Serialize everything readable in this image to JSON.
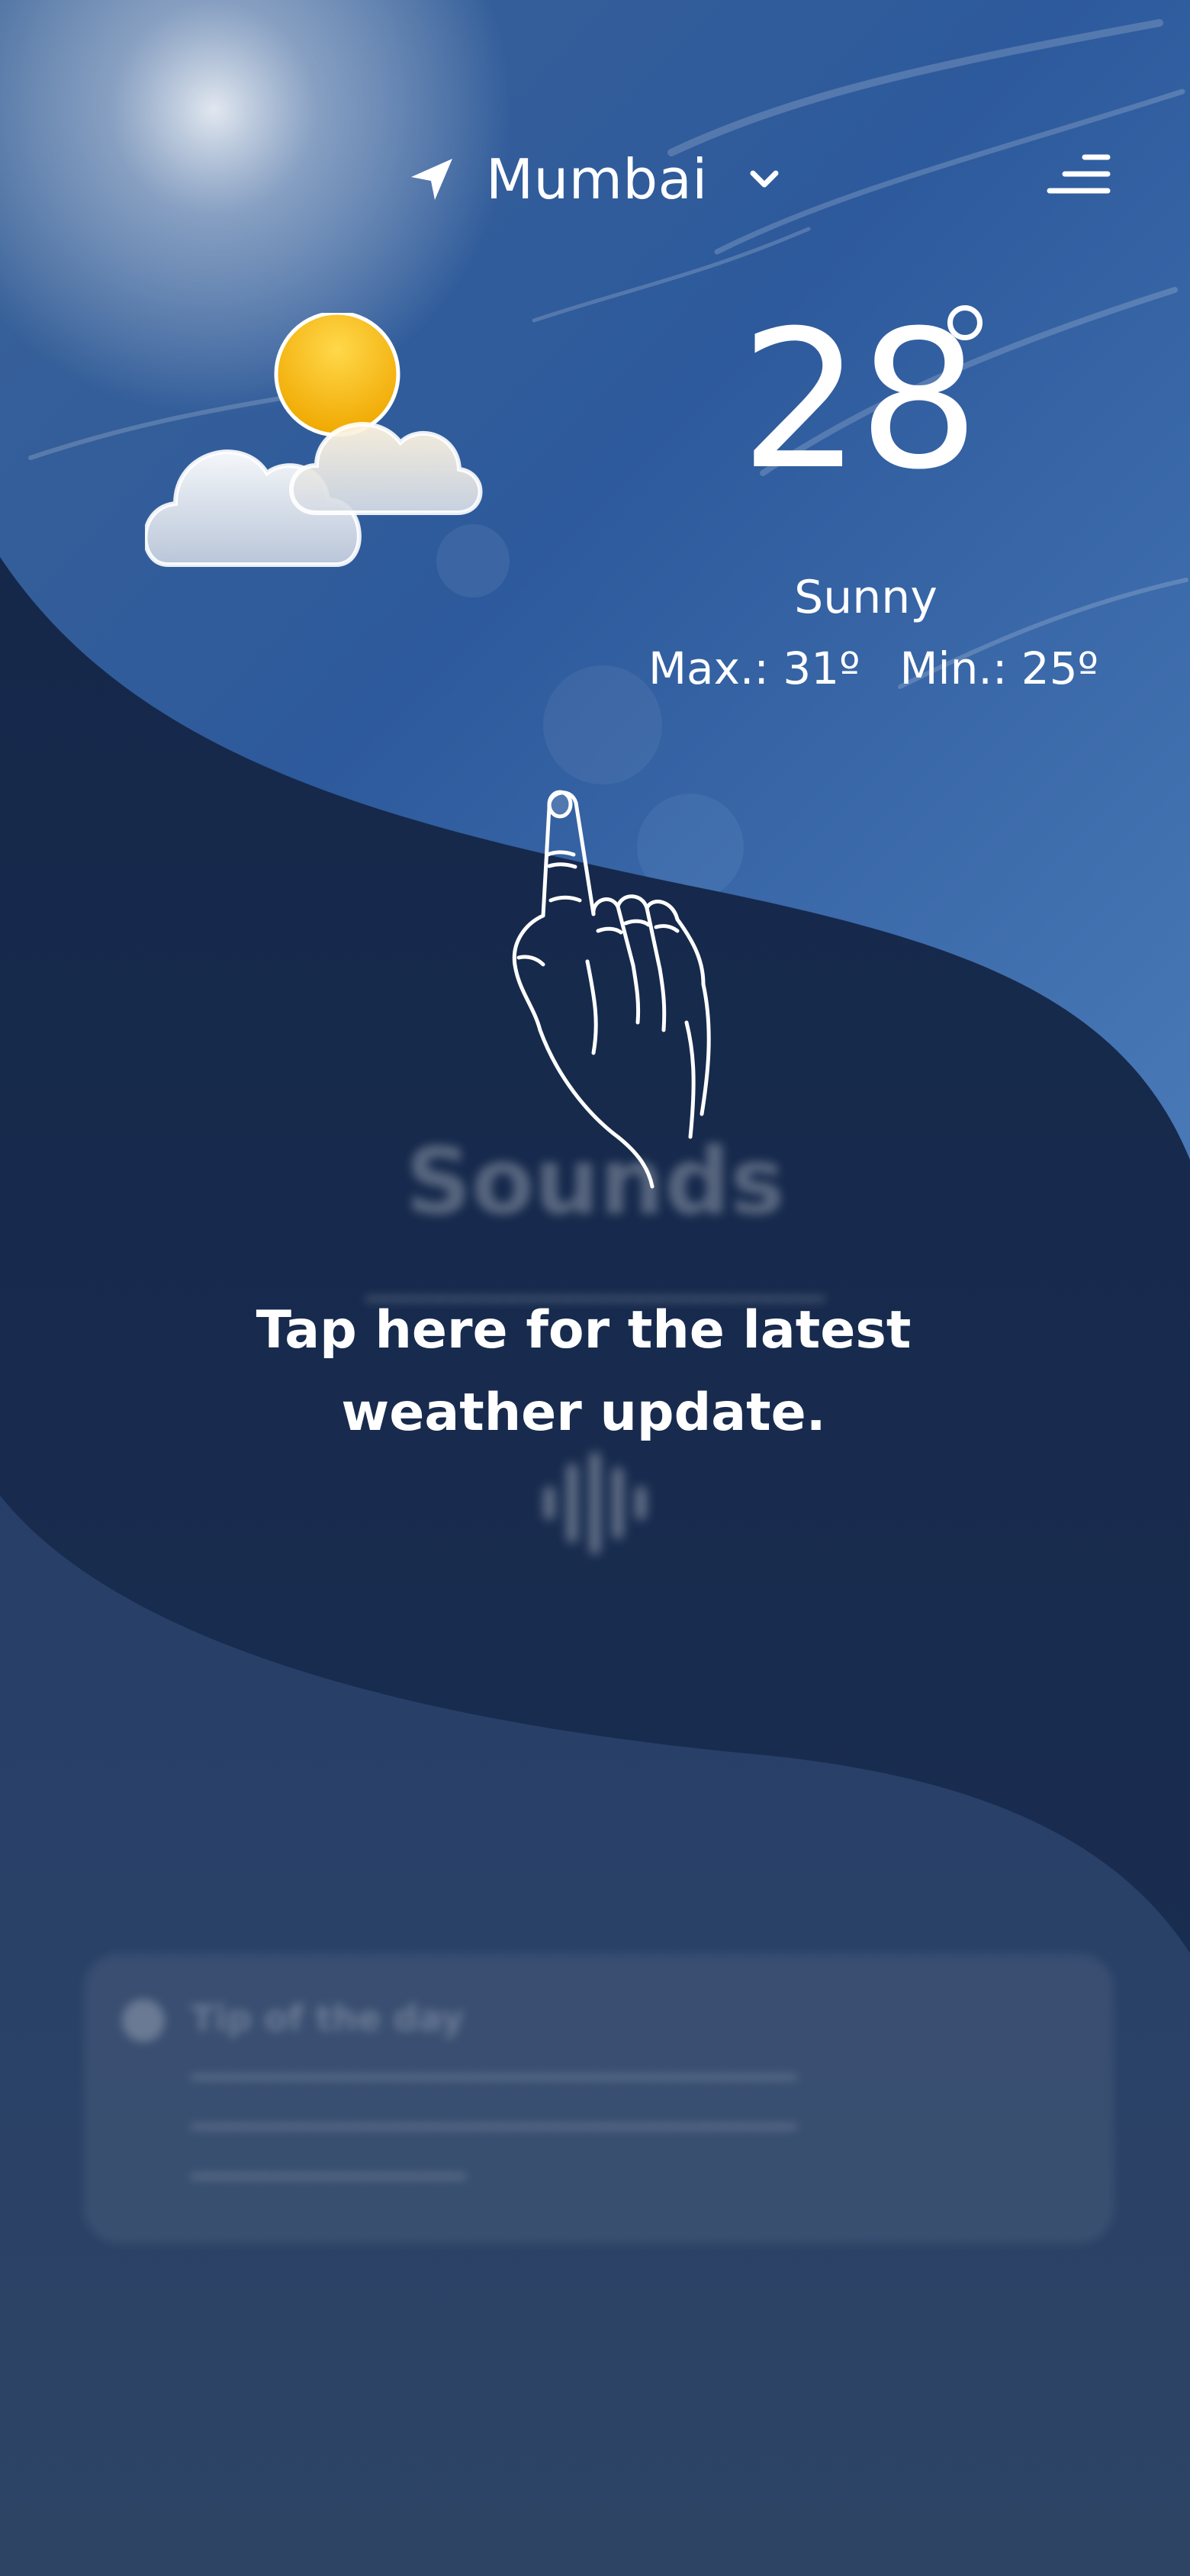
{
  "location": {
    "city": "Mumbai",
    "location_icon": "navigation-arrow-icon",
    "dropdown_icon": "chevron-down-icon"
  },
  "menu": {
    "icon": "menu-lines-icon"
  },
  "current": {
    "temperature": "28",
    "condition": "Sunny",
    "max_label": "Max.: 31º",
    "min_label": "Min.: 25º",
    "weather_icon": "partly-cloudy-sun-icon"
  },
  "coach_mark": {
    "text": "Tap here for the latest weather update.",
    "hand_icon": "pointing-hand-icon"
  },
  "background_sections": {
    "sounds_title": "Sounds",
    "tip_title": "Tip of the day"
  },
  "colors": {
    "sky_top": "#2f5fa3",
    "sky_bottom": "#4a77b3",
    "overlay_navy": "#17294b",
    "page_bg": "#2c4160",
    "sun": "#f5b800",
    "text": "#ffffff"
  }
}
